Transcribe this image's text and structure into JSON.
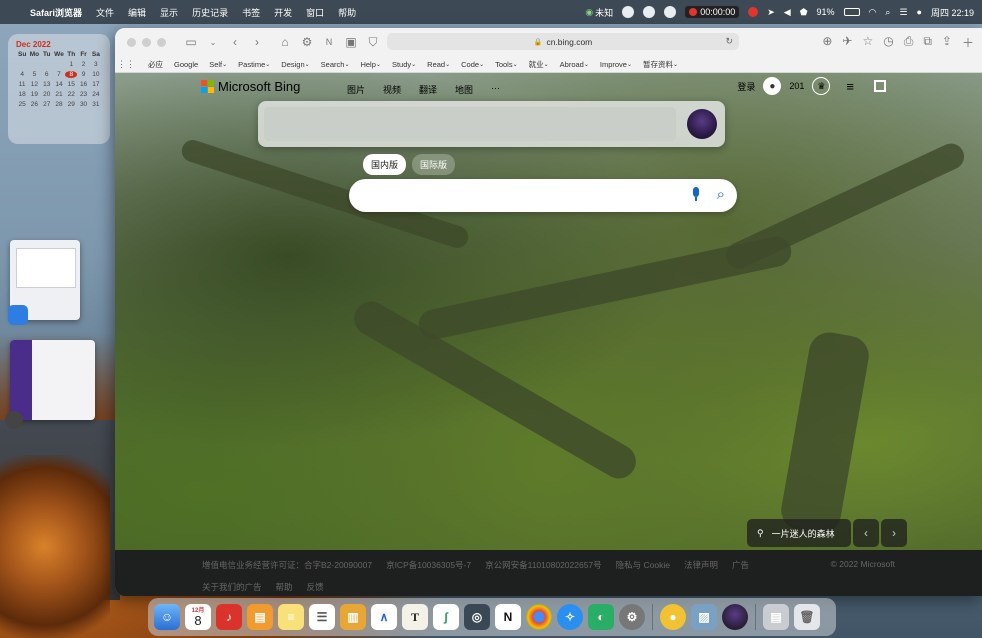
{
  "menubar": {
    "app_name": "Safari浏览器",
    "items": [
      "文件",
      "编辑",
      "显示",
      "历史记录",
      "书签",
      "开发",
      "窗口",
      "帮助"
    ],
    "status_vpn": "未知",
    "record_time": "00:00:00",
    "battery": "91%",
    "clock": "周四 22:19"
  },
  "calendar": {
    "title": "Dec 2022",
    "weekdays": [
      "Su",
      "Mo",
      "Tu",
      "We",
      "Th",
      "Fr",
      "Sa"
    ],
    "weeks": [
      [
        "",
        "",
        "",
        "",
        "1",
        "2",
        "3"
      ],
      [
        "4",
        "5",
        "6",
        "7",
        "8",
        "9",
        "10"
      ],
      [
        "11",
        "12",
        "13",
        "14",
        "15",
        "16",
        "17"
      ],
      [
        "18",
        "19",
        "20",
        "21",
        "22",
        "23",
        "24"
      ],
      [
        "25",
        "26",
        "27",
        "28",
        "29",
        "30",
        "31"
      ]
    ],
    "today": "8"
  },
  "browser": {
    "url": "cn.bing.com",
    "favorites": [
      "必应",
      "Google",
      "Self",
      "Pastime",
      "Design",
      "Search",
      "Help",
      "Study",
      "Read",
      "Code",
      "Tools",
      "就业",
      "Abroad",
      "Improve",
      "暂存资料"
    ]
  },
  "bing": {
    "logo_text": "Microsoft Bing",
    "nav": [
      "图片",
      "视频",
      "翻译",
      "地图",
      "···"
    ],
    "login": "登录",
    "points": "201",
    "tabs": [
      "国内版",
      "国际版"
    ],
    "image_caption": "一片迷人的森林",
    "footer_row1": [
      "增值电信业务经营许可证：合字B2-20090007",
      "京ICP备10036305号-7",
      "京公网安备11010802022657号",
      "隐私与 Cookie",
      "法律声明",
      "广告"
    ],
    "footer_row2": [
      "关于我们的广告",
      "帮助",
      "反馈"
    ],
    "copyright": "© 2022 Microsoft"
  },
  "dock": {
    "calendar_month": "12月",
    "calendar_day": "8"
  },
  "colors": {
    "accent": "#1667c9",
    "ms_red": "#f25022",
    "ms_green": "#7fba00",
    "ms_blue": "#00a4ef",
    "ms_yellow": "#ffb900"
  }
}
